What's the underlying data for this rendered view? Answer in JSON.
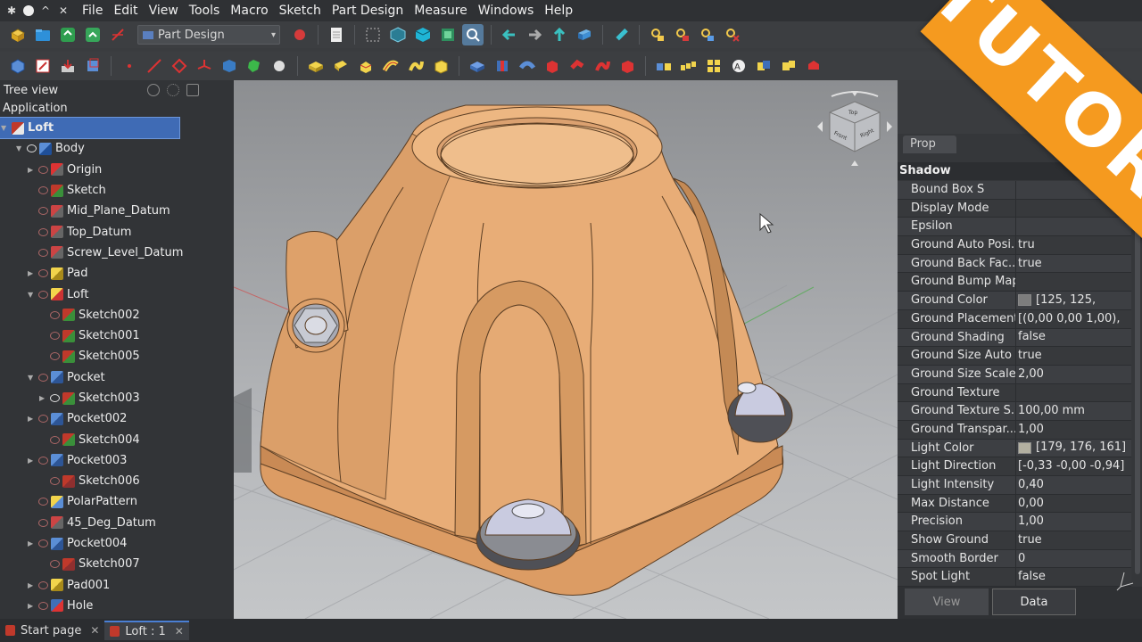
{
  "menubar": {
    "items": [
      "File",
      "Edit",
      "View",
      "Tools",
      "Macro",
      "Sketch",
      "Part Design",
      "Measure",
      "Windows",
      "Help"
    ]
  },
  "toolbar": {
    "workbench_selected": "Part Design"
  },
  "tree": {
    "header": "Tree view",
    "application_label": "Application",
    "items": [
      {
        "label": "Loft",
        "depth": 0,
        "selected": true,
        "icon": "document-icon",
        "visible": null
      },
      {
        "label": "Body",
        "depth": 1,
        "icon": "body-icon",
        "visible": true
      },
      {
        "label": "Origin",
        "depth": 2,
        "icon": "origin-icon",
        "visible": false
      },
      {
        "label": "Sketch",
        "depth": 2,
        "icon": "sketch-icon",
        "visible": false
      },
      {
        "label": "Mid_Plane_Datum",
        "depth": 2,
        "icon": "datum-plane-icon",
        "visible": false
      },
      {
        "label": "Top_Datum",
        "depth": 2,
        "icon": "datum-line-icon",
        "visible": false
      },
      {
        "label": "Screw_Level_Datum",
        "depth": 2,
        "icon": "datum-line-icon",
        "visible": false
      },
      {
        "label": "Pad",
        "depth": 2,
        "icon": "pad-icon",
        "visible": false
      },
      {
        "label": "Loft",
        "depth": 2,
        "icon": "loft-icon",
        "visible": false
      },
      {
        "label": "Sketch002",
        "depth": 3,
        "icon": "sketch-icon",
        "visible": false
      },
      {
        "label": "Sketch001",
        "depth": 3,
        "icon": "sketch-icon",
        "visible": false
      },
      {
        "label": "Sketch005",
        "depth": 3,
        "icon": "sketch-icon",
        "visible": false
      },
      {
        "label": "Pocket",
        "depth": 2,
        "icon": "pocket-icon",
        "visible": false
      },
      {
        "label": "Sketch003",
        "depth": 3,
        "icon": "sketch-icon",
        "visible": true
      },
      {
        "label": "Pocket002",
        "depth": 2,
        "icon": "pocket-icon",
        "visible": false
      },
      {
        "label": "Sketch004",
        "depth": 3,
        "icon": "sketch-icon",
        "visible": false
      },
      {
        "label": "Pocket003",
        "depth": 2,
        "icon": "pocket-icon",
        "visible": false
      },
      {
        "label": "Sketch006",
        "depth": 3,
        "icon": "sketch-red-icon",
        "visible": false
      },
      {
        "label": "PolarPattern",
        "depth": 2,
        "icon": "polar-pattern-icon",
        "visible": false
      },
      {
        "label": "45_Deg_Datum",
        "depth": 2,
        "icon": "datum-plane-icon",
        "visible": false
      },
      {
        "label": "Pocket004",
        "depth": 2,
        "icon": "pocket-icon",
        "visible": false
      },
      {
        "label": "Sketch007",
        "depth": 3,
        "icon": "sketch-red-icon",
        "visible": false
      },
      {
        "label": "Pad001",
        "depth": 2,
        "icon": "pad-icon",
        "visible": false
      },
      {
        "label": "Hole",
        "depth": 2,
        "icon": "hole-icon",
        "visible": false
      }
    ]
  },
  "properties": {
    "tab_label": "Prop",
    "group": "Shadow",
    "rows": [
      {
        "name": "Bound Box S",
        "value": ""
      },
      {
        "name": "Display Mode",
        "value": ""
      },
      {
        "name": "Epsilon",
        "value": ""
      },
      {
        "name": "Ground Auto Posi...",
        "value": "tru"
      },
      {
        "name": "Ground Back Fac...",
        "value": "true"
      },
      {
        "name": "Ground Bump Map",
        "value": ""
      },
      {
        "name": "Ground Color",
        "value": "[125, 125,",
        "swatch": "#7d7d7d"
      },
      {
        "name": "Ground Placement",
        "value": "[(0,00 0,00 1,00),",
        "expandable": true
      },
      {
        "name": "Ground Shading",
        "value": "false"
      },
      {
        "name": "Ground Size Auto",
        "value": "true"
      },
      {
        "name": "Ground Size Scale",
        "value": "2,00"
      },
      {
        "name": "Ground Texture",
        "value": ""
      },
      {
        "name": "Ground Texture S...",
        "value": "100,00 mm"
      },
      {
        "name": "Ground Transpar...",
        "value": "1,00"
      },
      {
        "name": "Light Color",
        "value": "[179, 176, 161]",
        "swatch": "#b3b0a1"
      },
      {
        "name": "Light Direction",
        "value": "[-0,33 -0,00 -0,94]",
        "expandable": true
      },
      {
        "name": "Light Intensity",
        "value": "0,40"
      },
      {
        "name": "Max Distance",
        "value": "0,00"
      },
      {
        "name": "Precision",
        "value": "1,00"
      },
      {
        "name": "Show Ground",
        "value": "true"
      },
      {
        "name": "Smooth Border",
        "value": "0"
      },
      {
        "name": "Spot Light",
        "value": "false"
      }
    ],
    "bottom_tabs": [
      {
        "label": "View",
        "active": false
      },
      {
        "label": "Data",
        "active": true
      }
    ]
  },
  "navcube": {
    "top_label": "Top",
    "front_label": "Front",
    "right_label": "Right"
  },
  "statusbar": {
    "tabs": [
      {
        "label": "Start page",
        "active": false
      },
      {
        "label": "Loft : 1",
        "active": true
      }
    ]
  },
  "banner": {
    "text": "TUTORIAL"
  },
  "colors": {
    "part": "#e8ad77",
    "banner": "#f59a1f",
    "selection": "#3f6bb5"
  }
}
